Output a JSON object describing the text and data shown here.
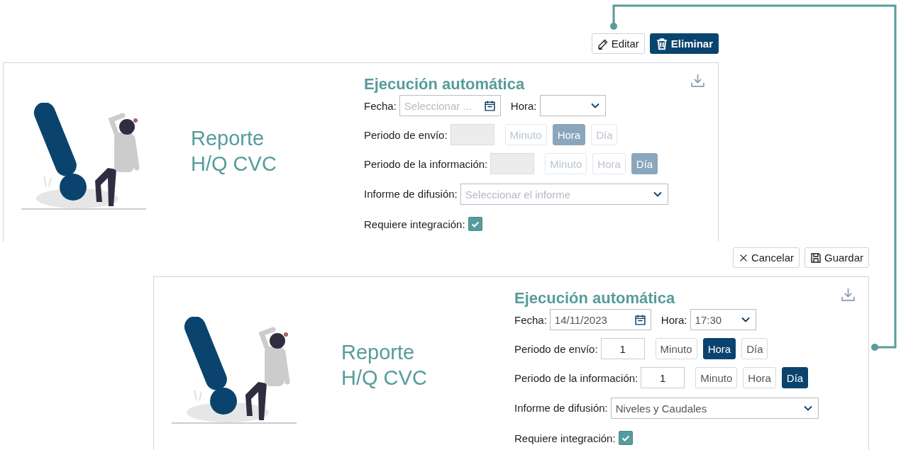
{
  "cards": [
    {
      "editing": false,
      "actions": [
        {
          "kind": "edit",
          "label": "Editar"
        },
        {
          "kind": "delete",
          "label": "Eliminar"
        }
      ],
      "title": "Reporte H/Q CVC",
      "form": {
        "heading": "Ejecución automática",
        "date": {
          "label": "Fecha:",
          "placeholder": "Seleccionar ..."
        },
        "time": {
          "label": "Hora:"
        },
        "periods": [
          {
            "label": "Periodo de envío:",
            "units": [
              {
                "label": "Minuto",
                "selected": false
              },
              {
                "label": "Hora",
                "selected": true
              },
              {
                "label": "Día",
                "selected": false
              }
            ]
          },
          {
            "label": "Periodo de la información:",
            "units": [
              {
                "label": "Minuto",
                "selected": false
              },
              {
                "label": "Hora",
                "selected": false
              },
              {
                "label": "Día",
                "selected": true
              }
            ]
          }
        ],
        "report": {
          "label": "Informe de difusión:",
          "placeholder": "Seleccionar el informe"
        },
        "integration": {
          "label": "Requiere integración:",
          "checked": true
        }
      }
    },
    {
      "editing": true,
      "actions": [
        {
          "kind": "cancel",
          "label": "Cancelar"
        },
        {
          "kind": "save",
          "label": "Guardar"
        }
      ],
      "title": "Reporte H/Q CVC",
      "form": {
        "heading": "Ejecución automática",
        "date": {
          "label": "Fecha:",
          "value": "14/11/2023"
        },
        "time": {
          "label": "Hora:",
          "value": "17:30"
        },
        "periods": [
          {
            "label": "Periodo de envío:",
            "value": "1",
            "units": [
              {
                "label": "Minuto",
                "selected": false
              },
              {
                "label": "Hora",
                "selected": true
              },
              {
                "label": "Día",
                "selected": false
              }
            ]
          },
          {
            "label": "Periodo de la información:",
            "value": "1",
            "units": [
              {
                "label": "Minuto",
                "selected": false
              },
              {
                "label": "Hora",
                "selected": false
              },
              {
                "label": "Día",
                "selected": true
              }
            ]
          }
        ],
        "report": {
          "label": "Informe de difusión:",
          "value": "Niveles y Caudales"
        },
        "integration": {
          "label": "Requiere integración:",
          "checked": true
        }
      }
    }
  ]
}
